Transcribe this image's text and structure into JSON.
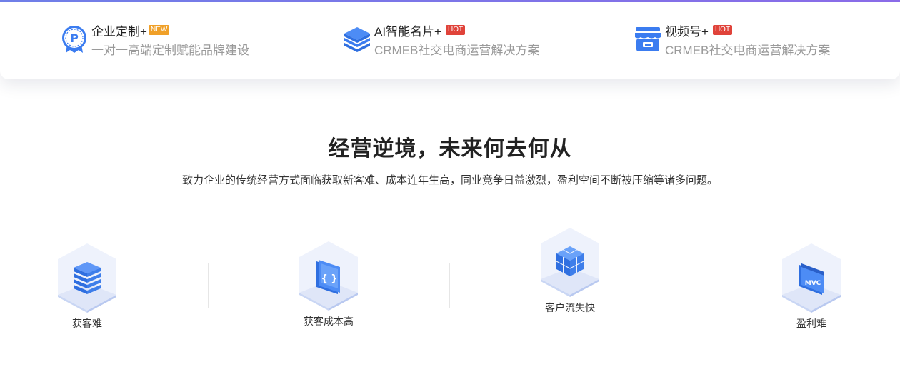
{
  "features": [
    {
      "title": "企业定制+",
      "badge": "NEW",
      "subtitle": "一对一高端定制赋能品牌建设",
      "icon": "badge-p-icon"
    },
    {
      "title": "AI智能名片+",
      "badge": "HOT",
      "subtitle": "CRMEB社交电商运营解决方案",
      "icon": "layers-icon"
    },
    {
      "title": "视频号+",
      "badge": "HOT",
      "subtitle": "CRMEB社交电商运营解决方案",
      "icon": "store-icon"
    }
  ],
  "section": {
    "title": "经营逆境，未来何去何从",
    "subtitle": "致力企业的传统经营方式面临获取新客难、成本连年生高，同业竞争日益激烈，盈利空间不断被压缩等诸多问题。"
  },
  "pain_points": [
    {
      "label": "获客难",
      "icon": "server-stack-icon"
    },
    {
      "label": "获客成本高",
      "icon": "code-braces-icon"
    },
    {
      "label": "客户流失快",
      "icon": "cube-blocks-icon"
    },
    {
      "label": "盈利难",
      "icon": "mvc-window-icon"
    }
  ],
  "colors": {
    "accent": "#3b7cf0",
    "new_badge": "#f0a028",
    "hot_badge": "#e0433a"
  }
}
